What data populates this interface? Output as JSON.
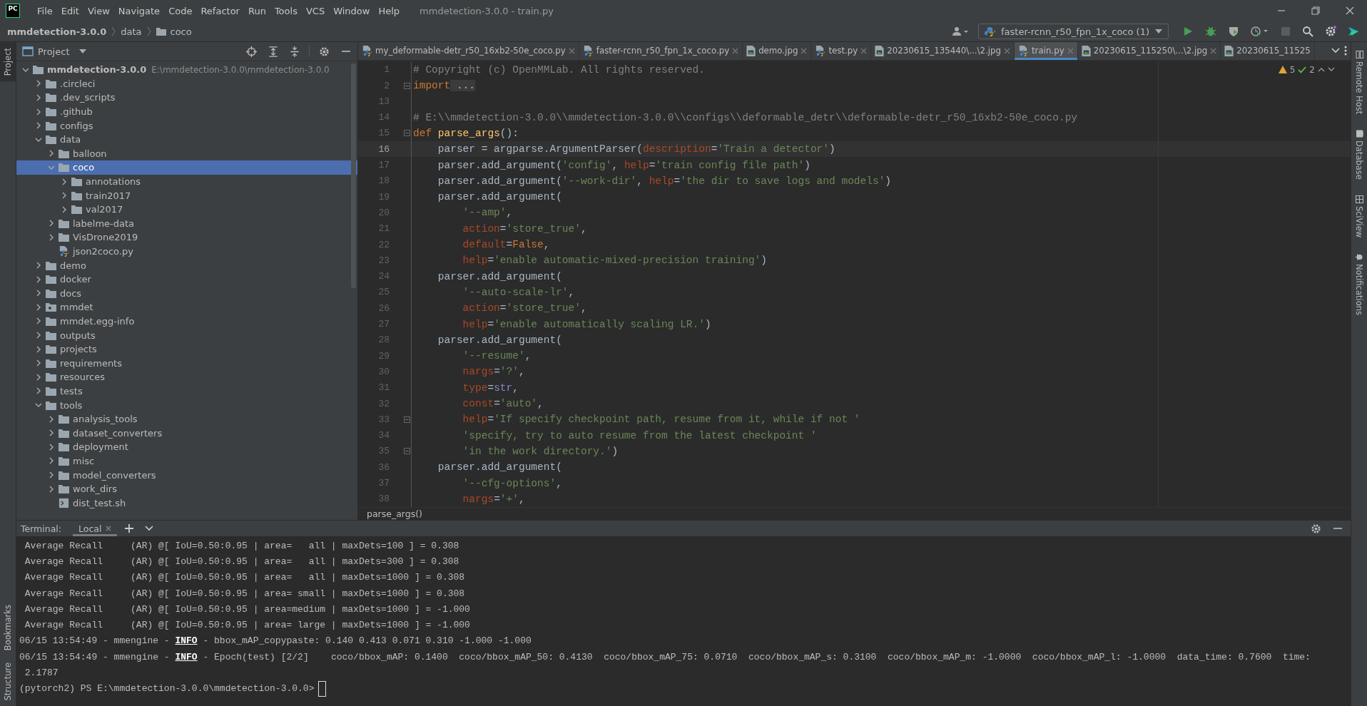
{
  "title_bar": {
    "app_icon": "PC",
    "menu": [
      "File",
      "Edit",
      "View",
      "Navigate",
      "Code",
      "Refactor",
      "Run",
      "Tools",
      "VCS",
      "Window",
      "Help"
    ],
    "title": "mmdetection-3.0.0 - train.py"
  },
  "navigation_bar": {
    "breadcrumbs": [
      {
        "label": "mmdetection-3.0.0",
        "kind": "project"
      },
      {
        "label": "data",
        "kind": "plain"
      },
      {
        "label": "coco",
        "kind": "folder"
      }
    ],
    "run_config": "faster-rcnn_r50_fpn_1x_coco (1)"
  },
  "left_strip": {
    "top": [
      {
        "label": "Project",
        "selected": true
      }
    ],
    "bottom": [
      {
        "label": "Bookmarks",
        "selected": false
      },
      {
        "label": "Structure",
        "selected": false
      }
    ]
  },
  "right_strip": [
    {
      "label": "Remote Host",
      "kind": "remote"
    },
    {
      "label": "Database",
      "kind": "database"
    },
    {
      "label": "SciView",
      "kind": "sciview"
    },
    {
      "label": "Notifications",
      "kind": "bell"
    }
  ],
  "project": {
    "title": "Project",
    "tree": [
      {
        "name": "mmdetection-3.0.0",
        "path": "E:\\mmdetection-3.0.0\\mmdetection-3.0.0",
        "kind": "folder",
        "expanded": true,
        "selected": false,
        "children": [
          {
            "name": ".circleci",
            "kind": "folder",
            "expanded": false,
            "selected": false
          },
          {
            "name": ".dev_scripts",
            "kind": "folder",
            "expanded": false,
            "selected": false
          },
          {
            "name": ".github",
            "kind": "folder",
            "expanded": false,
            "selected": false
          },
          {
            "name": "configs",
            "kind": "folder",
            "expanded": false,
            "selected": false
          },
          {
            "name": "data",
            "kind": "folder",
            "expanded": true,
            "selected": false,
            "children": [
              {
                "name": "balloon",
                "kind": "folder",
                "expanded": false,
                "selected": false
              },
              {
                "name": "coco",
                "kind": "folder",
                "expanded": true,
                "selected": true,
                "children": [
                  {
                    "name": "annotations",
                    "kind": "folder",
                    "expanded": false,
                    "selected": false
                  },
                  {
                    "name": "train2017",
                    "kind": "folder",
                    "expanded": false,
                    "selected": false
                  },
                  {
                    "name": "val2017",
                    "kind": "folder",
                    "expanded": false,
                    "selected": false
                  }
                ]
              },
              {
                "name": "labelme-data",
                "kind": "folder",
                "expanded": false,
                "selected": false
              },
              {
                "name": "VisDrone2019",
                "kind": "folder",
                "expanded": false,
                "selected": false
              },
              {
                "name": "json2coco.py",
                "kind": "python",
                "selected": false
              }
            ]
          },
          {
            "name": "demo",
            "kind": "folder",
            "expanded": false,
            "selected": false
          },
          {
            "name": "docker",
            "kind": "folder",
            "expanded": false,
            "selected": false
          },
          {
            "name": "docs",
            "kind": "folder",
            "expanded": false,
            "selected": false
          },
          {
            "name": "mmdet",
            "kind": "module",
            "expanded": false,
            "selected": false
          },
          {
            "name": "mmdet.egg-info",
            "kind": "folder",
            "expanded": false,
            "selected": false
          },
          {
            "name": "outputs",
            "kind": "folder",
            "expanded": false,
            "selected": false
          },
          {
            "name": "projects",
            "kind": "folder",
            "expanded": false,
            "selected": false
          },
          {
            "name": "requirements",
            "kind": "folder",
            "expanded": false,
            "selected": false
          },
          {
            "name": "resources",
            "kind": "folder",
            "expanded": false,
            "selected": false
          },
          {
            "name": "tests",
            "kind": "folder",
            "expanded": false,
            "selected": false
          },
          {
            "name": "tools",
            "kind": "folder",
            "expanded": true,
            "selected": false,
            "children": [
              {
                "name": "analysis_tools",
                "kind": "folder",
                "expanded": false,
                "selected": false
              },
              {
                "name": "dataset_converters",
                "kind": "folder",
                "expanded": false,
                "selected": false
              },
              {
                "name": "deployment",
                "kind": "folder",
                "expanded": false,
                "selected": false
              },
              {
                "name": "misc",
                "kind": "folder",
                "expanded": false,
                "selected": false
              },
              {
                "name": "model_converters",
                "kind": "folder",
                "expanded": false,
                "selected": false
              },
              {
                "name": "work_dirs",
                "kind": "folder",
                "expanded": false,
                "selected": false
              },
              {
                "name": "dist_test.sh",
                "kind": "shell",
                "selected": false
              }
            ]
          }
        ]
      }
    ]
  },
  "editor": {
    "tabs": [
      {
        "label": "my_deformable-detr_r50_16xb2-50e_coco.py",
        "kind": "python",
        "selected": false,
        "closable": true
      },
      {
        "label": "faster-rcnn_r50_fpn_1x_coco.py",
        "kind": "python",
        "selected": false,
        "closable": true
      },
      {
        "label": "demo.jpg",
        "kind": "image",
        "selected": false,
        "closable": true
      },
      {
        "label": "test.py",
        "kind": "python",
        "selected": false,
        "closable": true
      },
      {
        "label": "20230615_135440\\...\\2.jpg",
        "kind": "image",
        "selected": false,
        "closable": true
      },
      {
        "label": "train.py",
        "kind": "python",
        "selected": true,
        "closable": true
      },
      {
        "label": "20230615_115250\\...\\2.jpg",
        "kind": "image",
        "selected": false,
        "closable": true
      },
      {
        "label": "20230615_11525",
        "kind": "image",
        "selected": false,
        "closable": false
      }
    ],
    "inspections": {
      "warnings": "5",
      "checks": "2"
    },
    "lines": [
      {
        "number": "1",
        "current": false,
        "tokens": [
          {
            "kind": "comment",
            "text": "# Copyright (c) OpenMMLab. All rights reserved."
          }
        ]
      },
      {
        "number": "2",
        "current": false,
        "fold": true,
        "tokens": [
          {
            "kind": "keyword",
            "text": "import"
          },
          {
            "kind": "folded",
            "text": " ..."
          }
        ]
      },
      {
        "number": "13",
        "current": false
      },
      {
        "number": "14",
        "current": false,
        "tokens": [
          {
            "kind": "comment",
            "text": "# E:\\\\mmdetection-3.0.0\\\\mmdetection-3.0.0\\\\configs\\\\deformable_detr\\\\deformable-detr_r50_16xb2-50e_coco.py"
          }
        ]
      },
      {
        "number": "15",
        "current": false,
        "fold": true,
        "tokens": [
          {
            "kind": "keyword",
            "text": "def "
          },
          {
            "kind": "function",
            "text": "parse_args"
          },
          {
            "kind": "plain",
            "text": "():"
          }
        ]
      },
      {
        "number": "16",
        "current": true,
        "tokens": [
          {
            "kind": "plain",
            "text": "    parser = argparse.ArgumentParser("
          },
          {
            "kind": "param",
            "text": "description"
          },
          {
            "kind": "plain",
            "text": "="
          },
          {
            "kind": "string",
            "text": "'Train a detector'"
          },
          {
            "kind": "plain",
            "text": ")"
          }
        ]
      },
      {
        "number": "17",
        "current": false,
        "tokens": [
          {
            "kind": "plain",
            "text": "    parser.add_argument("
          },
          {
            "kind": "string",
            "text": "'config'"
          },
          {
            "kind": "plain",
            "text": ", "
          },
          {
            "kind": "param",
            "text": "help"
          },
          {
            "kind": "plain",
            "text": "="
          },
          {
            "kind": "string",
            "text": "'train config file path'"
          },
          {
            "kind": "plain",
            "text": ")"
          }
        ]
      },
      {
        "number": "18",
        "current": false,
        "tokens": [
          {
            "kind": "plain",
            "text": "    parser.add_argument("
          },
          {
            "kind": "string",
            "text": "'--work-dir'"
          },
          {
            "kind": "plain",
            "text": ", "
          },
          {
            "kind": "param",
            "text": "help"
          },
          {
            "kind": "plain",
            "text": "="
          },
          {
            "kind": "string",
            "text": "'the dir to save logs and models'"
          },
          {
            "kind": "plain",
            "text": ")"
          }
        ]
      },
      {
        "number": "19",
        "current": false,
        "tokens": [
          {
            "kind": "plain",
            "text": "    parser.add_argument("
          }
        ]
      },
      {
        "number": "20",
        "current": false,
        "tokens": [
          {
            "kind": "string",
            "text": "        '--amp'"
          },
          {
            "kind": "plain",
            "text": ","
          }
        ]
      },
      {
        "number": "21",
        "current": false,
        "tokens": [
          {
            "kind": "param",
            "text": "        action"
          },
          {
            "kind": "plain",
            "text": "="
          },
          {
            "kind": "string",
            "text": "'store_true'"
          },
          {
            "kind": "plain",
            "text": ","
          }
        ]
      },
      {
        "number": "22",
        "current": false,
        "tokens": [
          {
            "kind": "param",
            "text": "        default"
          },
          {
            "kind": "plain",
            "text": "="
          },
          {
            "kind": "keyword",
            "text": "False"
          },
          {
            "kind": "plain",
            "text": ","
          }
        ]
      },
      {
        "number": "23",
        "current": false,
        "tokens": [
          {
            "kind": "param",
            "text": "        help"
          },
          {
            "kind": "plain",
            "text": "="
          },
          {
            "kind": "string",
            "text": "'enable automatic-mixed-precision training'"
          },
          {
            "kind": "plain",
            "text": ")"
          }
        ]
      },
      {
        "number": "24",
        "current": false,
        "tokens": [
          {
            "kind": "plain",
            "text": "    parser.add_argument("
          }
        ]
      },
      {
        "number": "25",
        "current": false,
        "tokens": [
          {
            "kind": "string",
            "text": "        '--auto-scale-lr'"
          },
          {
            "kind": "plain",
            "text": ","
          }
        ]
      },
      {
        "number": "26",
        "current": false,
        "tokens": [
          {
            "kind": "param",
            "text": "        action"
          },
          {
            "kind": "plain",
            "text": "="
          },
          {
            "kind": "string",
            "text": "'store_true'"
          },
          {
            "kind": "plain",
            "text": ","
          }
        ]
      },
      {
        "number": "27",
        "current": false,
        "tokens": [
          {
            "kind": "param",
            "text": "        help"
          },
          {
            "kind": "plain",
            "text": "="
          },
          {
            "kind": "string",
            "text": "'enable automatically scaling LR.'"
          },
          {
            "kind": "plain",
            "text": ")"
          }
        ]
      },
      {
        "number": "28",
        "current": false,
        "tokens": [
          {
            "kind": "plain",
            "text": "    parser.add_argument("
          }
        ]
      },
      {
        "number": "29",
        "current": false,
        "tokens": [
          {
            "kind": "string",
            "text": "        '--resume'"
          },
          {
            "kind": "plain",
            "text": ","
          }
        ]
      },
      {
        "number": "30",
        "current": false,
        "tokens": [
          {
            "kind": "param",
            "text": "        nargs"
          },
          {
            "kind": "plain",
            "text": "="
          },
          {
            "kind": "string",
            "text": "'?'"
          },
          {
            "kind": "plain",
            "text": ","
          }
        ]
      },
      {
        "number": "31",
        "current": false,
        "tokens": [
          {
            "kind": "param",
            "text": "        type"
          },
          {
            "kind": "plain",
            "text": "="
          },
          {
            "kind": "builtin",
            "text": "str"
          },
          {
            "kind": "plain",
            "text": ","
          }
        ]
      },
      {
        "number": "32",
        "current": false,
        "tokens": [
          {
            "kind": "param",
            "text": "        const"
          },
          {
            "kind": "plain",
            "text": "="
          },
          {
            "kind": "string",
            "text": "'auto'"
          },
          {
            "kind": "plain",
            "text": ","
          }
        ]
      },
      {
        "number": "33",
        "current": false,
        "fold": true,
        "tokens": [
          {
            "kind": "param",
            "text": "        help"
          },
          {
            "kind": "plain",
            "text": "="
          },
          {
            "kind": "string",
            "text": "'If specify checkpoint path, resume from it, while if not '"
          }
        ]
      },
      {
        "number": "34",
        "current": false,
        "tokens": [
          {
            "kind": "string",
            "text": "        'specify, try to auto resume from the latest checkpoint '"
          }
        ]
      },
      {
        "number": "35",
        "current": false,
        "fold": true,
        "tokens": [
          {
            "kind": "string",
            "text": "        'in the work directory.'"
          },
          {
            "kind": "plain",
            "text": ")"
          }
        ]
      },
      {
        "number": "36",
        "current": false,
        "tokens": [
          {
            "kind": "plain",
            "text": "    parser.add_argument("
          }
        ]
      },
      {
        "number": "37",
        "current": false,
        "tokens": [
          {
            "kind": "string",
            "text": "        '--cfg-options'"
          },
          {
            "kind": "plain",
            "text": ","
          }
        ]
      },
      {
        "number": "38",
        "current": false,
        "tokens": [
          {
            "kind": "param",
            "text": "        nargs"
          },
          {
            "kind": "plain",
            "text": "="
          },
          {
            "kind": "string",
            "text": "'+'"
          },
          {
            "kind": "plain",
            "text": ","
          }
        ]
      }
    ],
    "breadcrumb": "parse_args()"
  },
  "terminal": {
    "title": "Terminal:",
    "tabs": [
      {
        "label": "Local",
        "selected": true
      }
    ],
    "lines": [
      " Average Recall     (AR) @[ IoU=0.50:0.95 | area=   all | maxDets=100 ] = 0.308",
      " Average Recall     (AR) @[ IoU=0.50:0.95 | area=   all | maxDets=300 ] = 0.308",
      " Average Recall     (AR) @[ IoU=0.50:0.95 | area=   all | maxDets=1000 ] = 0.308",
      " Average Recall     (AR) @[ IoU=0.50:0.95 | area= small | maxDets=1000 ] = 0.308",
      " Average Recall     (AR) @[ IoU=0.50:0.95 | area=medium | maxDets=1000 ] = -1.000",
      " Average Recall     (AR) @[ IoU=0.50:0.95 | area= large | maxDets=1000 ] = -1.000",
      "06/15 13:54:49 - mmengine - **INFO** - bbox_mAP_copypaste: 0.140 0.413 0.071 0.310 -1.000 -1.000",
      "06/15 13:54:49 - mmengine - **INFO** - Epoch(test) [2/2]    coco/bbox_mAP: 0.1400  coco/bbox_mAP_50: 0.4130  coco/bbox_mAP_75: 0.0710  coco/bbox_mAP_s: 0.3100  coco/bbox_mAP_m: -1.0000  coco/bbox_mAP_l: -1.0000  data_time: 0.7600  time:",
      " 2.1787"
    ],
    "prompt": "(pytorch2) PS E:\\mmdetection-3.0.0\\mmdetection-3.0.0>"
  }
}
